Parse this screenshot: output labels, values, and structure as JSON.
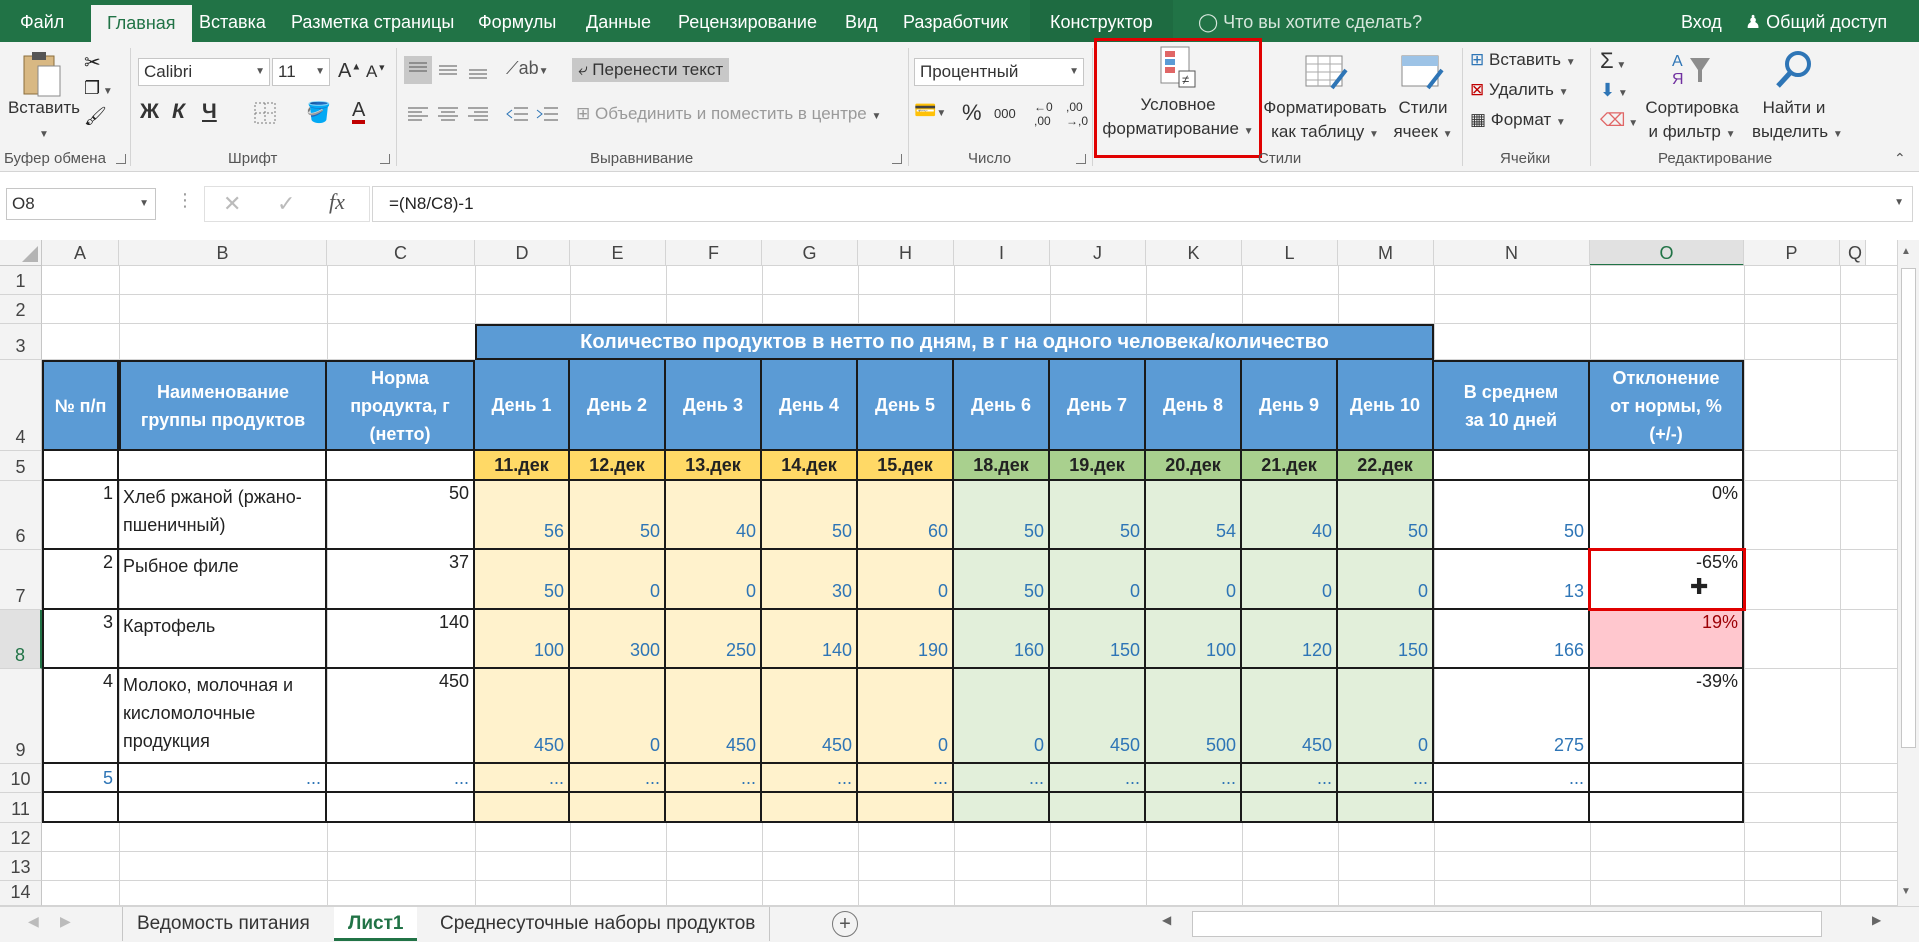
{
  "ribbon_tabs": [
    "Файл",
    "Главная",
    "Вставка",
    "Разметка страницы",
    "Формулы",
    "Данные",
    "Рецензирование",
    "Вид",
    "Разработчик",
    "Конструктор"
  ],
  "active_tab": "Главная",
  "tell_me": "Что вы хотите сделать?",
  "signin": "Вход",
  "share": "Общий доступ",
  "clipboard": {
    "paste": "Вставить",
    "label": "Буфер обмена"
  },
  "font": {
    "name": "Calibri",
    "size": "11",
    "label": "Шрифт",
    "bold": "Ж",
    "italic": "К",
    "underline": "Ч"
  },
  "alignment": {
    "wrap": "Перенести текст",
    "merge": "Объединить и поместить в центре",
    "label": "Выравнивание"
  },
  "number": {
    "format": "Процентный",
    "label": "Число",
    "percent": "%",
    "thousands": "000"
  },
  "styles": {
    "conditional_1": "Условное",
    "conditional_2": "форматирование",
    "table_1": "Форматировать",
    "table_2": "как таблицу",
    "cell_1": "Стили",
    "cell_2": "ячеек",
    "label": "Стили"
  },
  "cells": {
    "insert": "Вставить",
    "delete": "Удалить",
    "format": "Формат",
    "label": "Ячейки"
  },
  "editing": {
    "sort_1": "Сортировка",
    "sort_2": "и фильтр",
    "find_1": "Найти и",
    "find_2": "выделить",
    "label": "Редактирование"
  },
  "formula_bar": {
    "name_box": "O8",
    "fx": "fx",
    "formula": "=(N8/C8)-1"
  },
  "columns": [
    "A",
    "B",
    "C",
    "D",
    "E",
    "F",
    "G",
    "H",
    "I",
    "J",
    "K",
    "L",
    "M",
    "N",
    "O",
    "P",
    "Q"
  ],
  "rows": [
    "1",
    "2",
    "3",
    "4",
    "5",
    "6",
    "7",
    "8",
    "9",
    "10",
    "11",
    "12",
    "13",
    "14"
  ],
  "sheet": {
    "title": "Количество продуктов в нетто по дням, в г на одного человека/количество",
    "h_num": "№ п/п",
    "h_name_1": "Наименование",
    "h_name_2": "группы продуктов",
    "h_norm_1": "Норма",
    "h_norm_2": "продукта, г",
    "h_norm_3": "(нетто)",
    "days": [
      "День 1",
      "День 2",
      "День 3",
      "День 4",
      "День 5",
      "День 6",
      "День 7",
      "День 8",
      "День 9",
      "День 10"
    ],
    "h_avg_1": "В среднем",
    "h_avg_2": "за 10 дней",
    "h_dev_1": "Отклонение",
    "h_dev_2": "от нормы, %",
    "h_dev_3": "(+/-)",
    "dates": [
      "11.дек",
      "12.дек",
      "13.дек",
      "14.дек",
      "15.дек",
      "18.дек",
      "19.дек",
      "20.дек",
      "21.дек",
      "22.дек"
    ],
    "data_rows": [
      {
        "n": "1",
        "name_1": "Хлеб ржаной (ржано-",
        "name_2": "пшеничный)",
        "name_3": "",
        "norm": "50",
        "vals": [
          "56",
          "50",
          "40",
          "50",
          "60",
          "50",
          "50",
          "54",
          "40",
          "50"
        ],
        "avg": "50",
        "dev": "0%"
      },
      {
        "n": "2",
        "name_1": "Рыбное филе",
        "name_2": "",
        "name_3": "",
        "norm": "37",
        "vals": [
          "50",
          "0",
          "0",
          "30",
          "0",
          "50",
          "0",
          "0",
          "0",
          "0"
        ],
        "avg": "13",
        "dev": "-65%"
      },
      {
        "n": "3",
        "name_1": "Картофель",
        "name_2": "",
        "name_3": "",
        "norm": "140",
        "vals": [
          "100",
          "300",
          "250",
          "140",
          "190",
          "160",
          "150",
          "100",
          "120",
          "150"
        ],
        "avg": "166",
        "dev": "19%"
      },
      {
        "n": "4",
        "name_1": "Молоко, молочная и",
        "name_2": "кисломолочные",
        "name_3": "продукция",
        "norm": "450",
        "vals": [
          "450",
          "0",
          "450",
          "450",
          "0",
          "0",
          "450",
          "500",
          "450",
          "0"
        ],
        "avg": "275",
        "dev": "-39%"
      }
    ],
    "row10_n": "5",
    "ellipsis": "..."
  },
  "sheet_tabs": [
    "Ведомость питания",
    "Лист1",
    "Среднесуточные наборы продуктов"
  ],
  "active_sheet": "Лист1"
}
